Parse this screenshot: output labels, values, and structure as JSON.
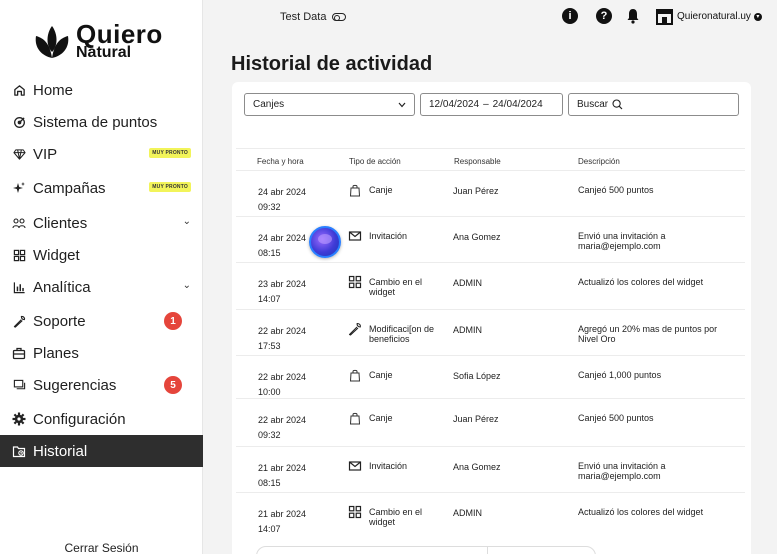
{
  "brand": {
    "title": "Quiero",
    "subtitle": "Natural"
  },
  "sidebar": {
    "items": [
      {
        "label": "Home",
        "icon": "home-icon"
      },
      {
        "label": "Sistema de puntos",
        "icon": "points-icon"
      },
      {
        "label": "VIP",
        "icon": "diamond-icon",
        "badge": "MUY PRONTO"
      },
      {
        "label": "Campañas",
        "icon": "sparkle-icon",
        "badge": "MUY PRONTO"
      },
      {
        "label": "Clientes",
        "icon": "users-icon",
        "chevron": "⌄"
      },
      {
        "label": "Widget",
        "icon": "grid-icon"
      },
      {
        "label": "Analítica",
        "icon": "bar-chart-icon",
        "chevron": "⌄"
      },
      {
        "label": "Soporte",
        "icon": "wrench-icon",
        "count": "1"
      },
      {
        "label": "Planes",
        "icon": "briefcase-icon"
      },
      {
        "label": "Sugerencias",
        "icon": "message-icon",
        "count": "5"
      },
      {
        "label": "Configuración",
        "icon": "gear-icon"
      },
      {
        "label": "Historial",
        "icon": "history-icon",
        "active": true
      }
    ],
    "logout": "Cerrar Sesión"
  },
  "topbar": {
    "test_data": "Test Data",
    "store_name": "Quieronatural.uy"
  },
  "page": {
    "title": "Historial de actividad"
  },
  "filters": {
    "type_value": "Canjes",
    "date_start": "12/04/2024",
    "date_sep": "–",
    "date_end": "24/04/2024",
    "search_label": "Buscar"
  },
  "table": {
    "headers": [
      "Fecha y hora",
      "Tipo de acción",
      "Responsable",
      "Descripción"
    ],
    "rows": [
      {
        "date": "24 abr 2024",
        "time": "09:32",
        "type": "Canje",
        "icon": "bag-icon",
        "resp": "Juan Pérez",
        "desc": "Canjeó 500 puntos"
      },
      {
        "date": "24 abr 2024",
        "time": "08:15",
        "type": "Invitación",
        "icon": "mail-icon",
        "resp": "Ana Gomez",
        "desc": "Envió una invitación a maria@ejemplo.com"
      },
      {
        "date": "23 abr 2024",
        "time": "14:07",
        "type": "Cambio en el widget",
        "icon": "grid-icon",
        "resp": "ADMIN",
        "desc": "Actualizó los colores del widget"
      },
      {
        "date": "22 abr 2024",
        "time": "17:53",
        "type": "Modificaci[on de beneficios",
        "icon": "wrench-icon",
        "resp": "ADMIN",
        "desc": "Agregó un 20% mas de puntos por Nivel Oro"
      },
      {
        "date": "22 abr 2024",
        "time": "10:00",
        "type": "Canje",
        "icon": "bag-icon",
        "resp": "Sofia López",
        "desc": "Canjeó 1,000 puntos"
      },
      {
        "date": "22 abr 2024",
        "time": "09:32",
        "type": "Canje",
        "icon": "bag-icon",
        "resp": "Juan Pérez",
        "desc": "Canjeó 500 puntos"
      },
      {
        "date": "21 abr 2024",
        "time": "08:15",
        "type": "Invitación",
        "icon": "mail-icon",
        "resp": "Ana Gomez",
        "desc": "Envió una invitación a maria@ejemplo.com"
      },
      {
        "date": "21 abr 2024",
        "time": "14:07",
        "type": "Cambio en el widget",
        "icon": "grid-icon",
        "resp": "ADMIN",
        "desc": "Actualizó los colores del widget"
      }
    ]
  },
  "colors": {
    "active_bg": "#2e2e2e",
    "badge_soon": "#f2f45a",
    "badge_count": "#e5453b"
  }
}
